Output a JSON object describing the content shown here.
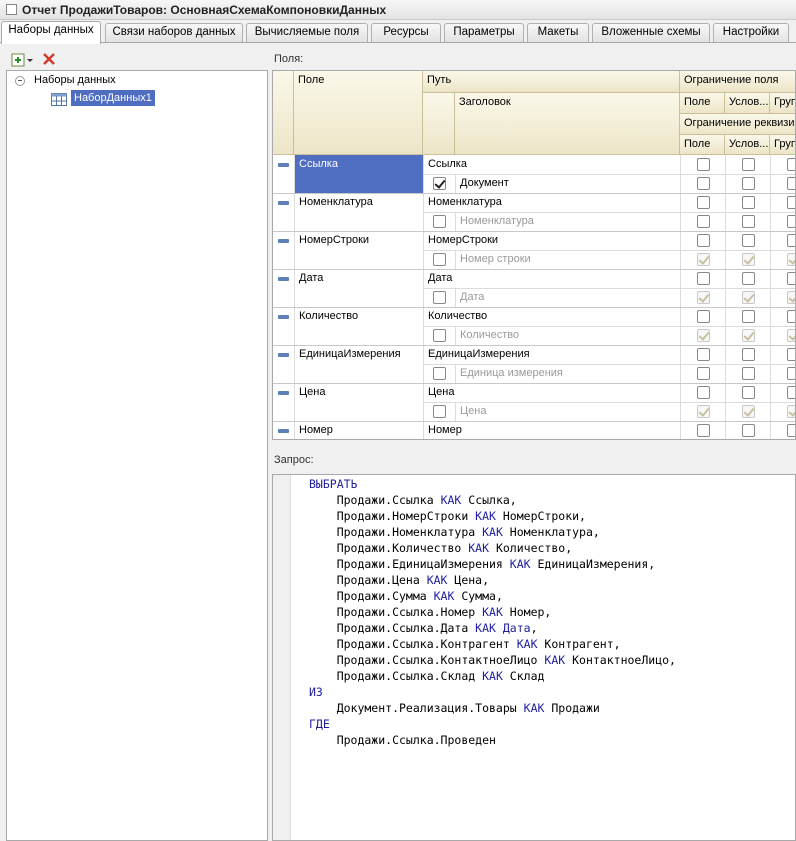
{
  "window": {
    "title": "Отчет ПродажиТоваров: ОсновнаяСхемаКомпоновкиДанных"
  },
  "tabs": [
    {
      "label": "Наборы данных",
      "active": true
    },
    {
      "label": "Связи наборов данных"
    },
    {
      "label": "Вычисляемые поля"
    },
    {
      "label": "Ресурсы"
    },
    {
      "label": "Параметры"
    },
    {
      "label": "Макеты"
    },
    {
      "label": "Вложенные схемы"
    },
    {
      "label": "Настройки"
    }
  ],
  "tree": {
    "root_label": "Наборы данных",
    "items": [
      {
        "label": "НаборДанных1",
        "selected": true
      }
    ]
  },
  "fields": {
    "label": "Поля:",
    "headers": {
      "field": "Поле",
      "path": "Путь",
      "title": "Заголовок",
      "restrict_field": "Ограничение поля",
      "restrict_attr": "Ограничение реквизи",
      "sub_field": "Поле",
      "sub_cond": "Услов...",
      "sub_group": "Груп"
    },
    "rows": [
      {
        "field": "Ссылка",
        "path": "Ссылка",
        "title": "Документ",
        "title_checked": true,
        "title_enabled": true,
        "selected": true,
        "r1": [
          false,
          false,
          false
        ],
        "r2": [
          false,
          false,
          false
        ],
        "r2_enabled": true
      },
      {
        "field": "Номенклатура",
        "path": "Номенклатура",
        "title": "Номенклатура",
        "title_checked": false,
        "title_enabled": false,
        "r1": [
          false,
          false,
          false
        ],
        "r2": [
          false,
          false,
          false
        ],
        "r2_enabled": true
      },
      {
        "field": "НомерСтроки",
        "path": "НомерСтроки",
        "title": "Номер строки",
        "title_checked": false,
        "title_enabled": false,
        "r1": [
          false,
          false,
          false
        ],
        "r2": [
          true,
          true,
          true
        ],
        "r2_enabled": false
      },
      {
        "field": "Дата",
        "path": "Дата",
        "title": "Дата",
        "title_checked": false,
        "title_enabled": false,
        "r1": [
          false,
          false,
          false
        ],
        "r2": [
          true,
          true,
          true
        ],
        "r2_enabled": false
      },
      {
        "field": "Количество",
        "path": "Количество",
        "title": "Количество",
        "title_checked": false,
        "title_enabled": false,
        "r1": [
          false,
          false,
          false
        ],
        "r2": [
          true,
          true,
          true
        ],
        "r2_enabled": false
      },
      {
        "field": "ЕдиницаИзмерения",
        "path": "ЕдиницаИзмерения",
        "title": "Единица измерения",
        "title_checked": false,
        "title_enabled": false,
        "r1": [
          false,
          false,
          false
        ],
        "r2": [
          false,
          false,
          false
        ],
        "r2_enabled": true
      },
      {
        "field": "Цена",
        "path": "Цена",
        "title": "Цена",
        "title_checked": false,
        "title_enabled": false,
        "r1": [
          false,
          false,
          false
        ],
        "r2": [
          true,
          true,
          true
        ],
        "r2_enabled": false
      },
      {
        "field": "Номер",
        "path": "Номер",
        "r1": [
          false,
          false,
          false
        ]
      }
    ]
  },
  "query": {
    "label": "Запрос:",
    "lines": [
      [
        {
          "t": "ВЫБРАТЬ",
          "k": 1
        }
      ],
      [
        {
          "t": "    Продажи.Ссылка "
        },
        {
          "t": "КАК",
          "k": 1
        },
        {
          "t": " Ссылка,"
        }
      ],
      [
        {
          "t": "    Продажи.НомерСтроки "
        },
        {
          "t": "КАК",
          "k": 1
        },
        {
          "t": " НомерСтроки,"
        }
      ],
      [
        {
          "t": "    Продажи.Номенклатура "
        },
        {
          "t": "КАК",
          "k": 1
        },
        {
          "t": " Номенклатура,"
        }
      ],
      [
        {
          "t": "    Продажи.Количество "
        },
        {
          "t": "КАК",
          "k": 1
        },
        {
          "t": " Количество,"
        }
      ],
      [
        {
          "t": "    Продажи.ЕдиницаИзмерения "
        },
        {
          "t": "КАК",
          "k": 1
        },
        {
          "t": " ЕдиницаИзмерения,"
        }
      ],
      [
        {
          "t": "    Продажи.Цена "
        },
        {
          "t": "КАК",
          "k": 1
        },
        {
          "t": " Цена,"
        }
      ],
      [
        {
          "t": "    Продажи.Сумма "
        },
        {
          "t": "КАК",
          "k": 1
        },
        {
          "t": " Сумма,"
        }
      ],
      [
        {
          "t": "    Продажи.Ссылка.Номер "
        },
        {
          "t": "КАК",
          "k": 1
        },
        {
          "t": " Номер,"
        }
      ],
      [
        {
          "t": "    Продажи.Ссылка.Дата "
        },
        {
          "t": "КАК Дата",
          "k": 1
        },
        {
          "t": ","
        }
      ],
      [
        {
          "t": "    Продажи.Ссылка.Контрагент "
        },
        {
          "t": "КАК",
          "k": 1
        },
        {
          "t": " Контрагент,"
        }
      ],
      [
        {
          "t": "    Продажи.Ссылка.КонтактноеЛицо "
        },
        {
          "t": "КАК",
          "k": 1
        },
        {
          "t": " КонтактноеЛицо,"
        }
      ],
      [
        {
          "t": "    Продажи.Ссылка.Склад "
        },
        {
          "t": "КАК",
          "k": 1
        },
        {
          "t": " Склад"
        }
      ],
      [
        {
          "t": "ИЗ",
          "k": 1
        }
      ],
      [
        {
          "t": "    Документ.Реализация.Товары "
        },
        {
          "t": "КАК",
          "k": 1
        },
        {
          "t": " Продажи"
        }
      ],
      [
        {
          "t": "ГДЕ",
          "k": 1
        }
      ],
      [
        {
          "t": "    Продажи.Ссылка.Проведен"
        }
      ]
    ]
  },
  "colors": {
    "accent": "#4f6dc1",
    "keyword": "#1e1e9e",
    "header": "#efe9cf"
  }
}
